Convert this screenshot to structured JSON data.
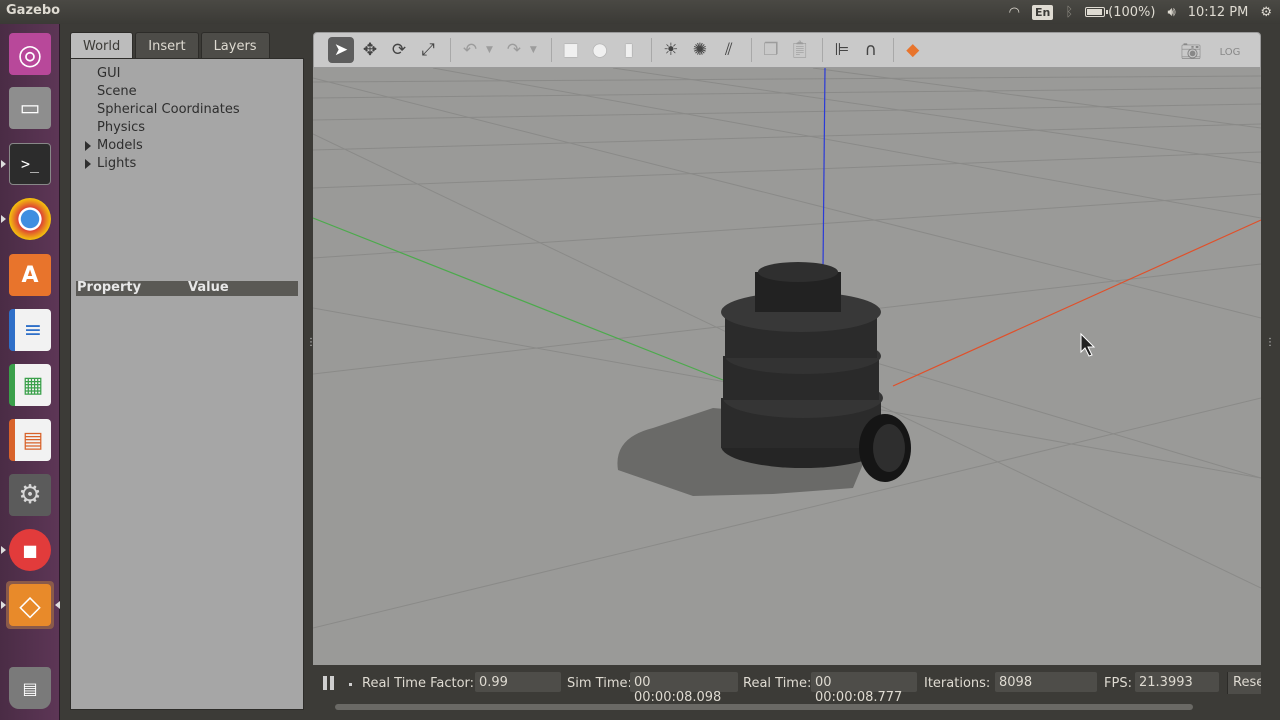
{
  "topbar": {
    "app_title": "Gazebo",
    "keyboard_layout": "En",
    "battery_text": "(100%)",
    "battery_level": 1.0,
    "clock": "10:12 PM"
  },
  "launcher": {
    "items": [
      {
        "name": "dash",
        "glyph": "◎",
        "color": "#c04ea0"
      },
      {
        "name": "files",
        "glyph": "▭",
        "color": "#8a8a8a"
      },
      {
        "name": "terminal",
        "glyph": ">_",
        "color": "#2c2c2c"
      },
      {
        "name": "chrome",
        "glyph": "●",
        "color": "#3f8ee0"
      },
      {
        "name": "software-center",
        "glyph": "A",
        "color": "#e8742c"
      },
      {
        "name": "writer",
        "glyph": "≡",
        "color": "#2e6fc8"
      },
      {
        "name": "calc",
        "glyph": "▦",
        "color": "#3aa04a"
      },
      {
        "name": "impress",
        "glyph": "▤",
        "color": "#d8622a"
      },
      {
        "name": "system-settings",
        "glyph": "⚙",
        "color": "#6e6e6e"
      },
      {
        "name": "recorder",
        "glyph": "●",
        "color": "#e23b3b"
      },
      {
        "name": "gazebo",
        "glyph": "◇",
        "color": "#e88a2a"
      },
      {
        "name": "trash",
        "glyph": "🗑",
        "color": "#7a7a7a"
      }
    ]
  },
  "leftpanel": {
    "tabs": [
      "World",
      "Insert",
      "Layers"
    ],
    "tree": [
      "GUI",
      "Scene",
      "Spherical Coordinates",
      "Physics",
      "Models",
      "Lights"
    ],
    "property_header": "Property",
    "value_header": "Value"
  },
  "bottombar": {
    "real_time_factor_label": "Real Time Factor:",
    "real_time_factor": "0.99",
    "sim_time_label": "Sim Time:",
    "sim_time": "00 00:00:08.098",
    "real_time_label": "Real Time:",
    "real_time": "00 00:00:08.777",
    "iterations_label": "Iterations:",
    "iterations": "8098",
    "fps_label": "FPS:",
    "fps": "21.3993",
    "reset_label": "Reset"
  },
  "colors": {
    "x_axis": "#e0502a",
    "y_axis": "#4caa4c",
    "z_axis": "#2a3ad8",
    "viewport_bg": "#9a9a98",
    "robot": "#2b2b2b",
    "shadow": "#6a6a68"
  }
}
